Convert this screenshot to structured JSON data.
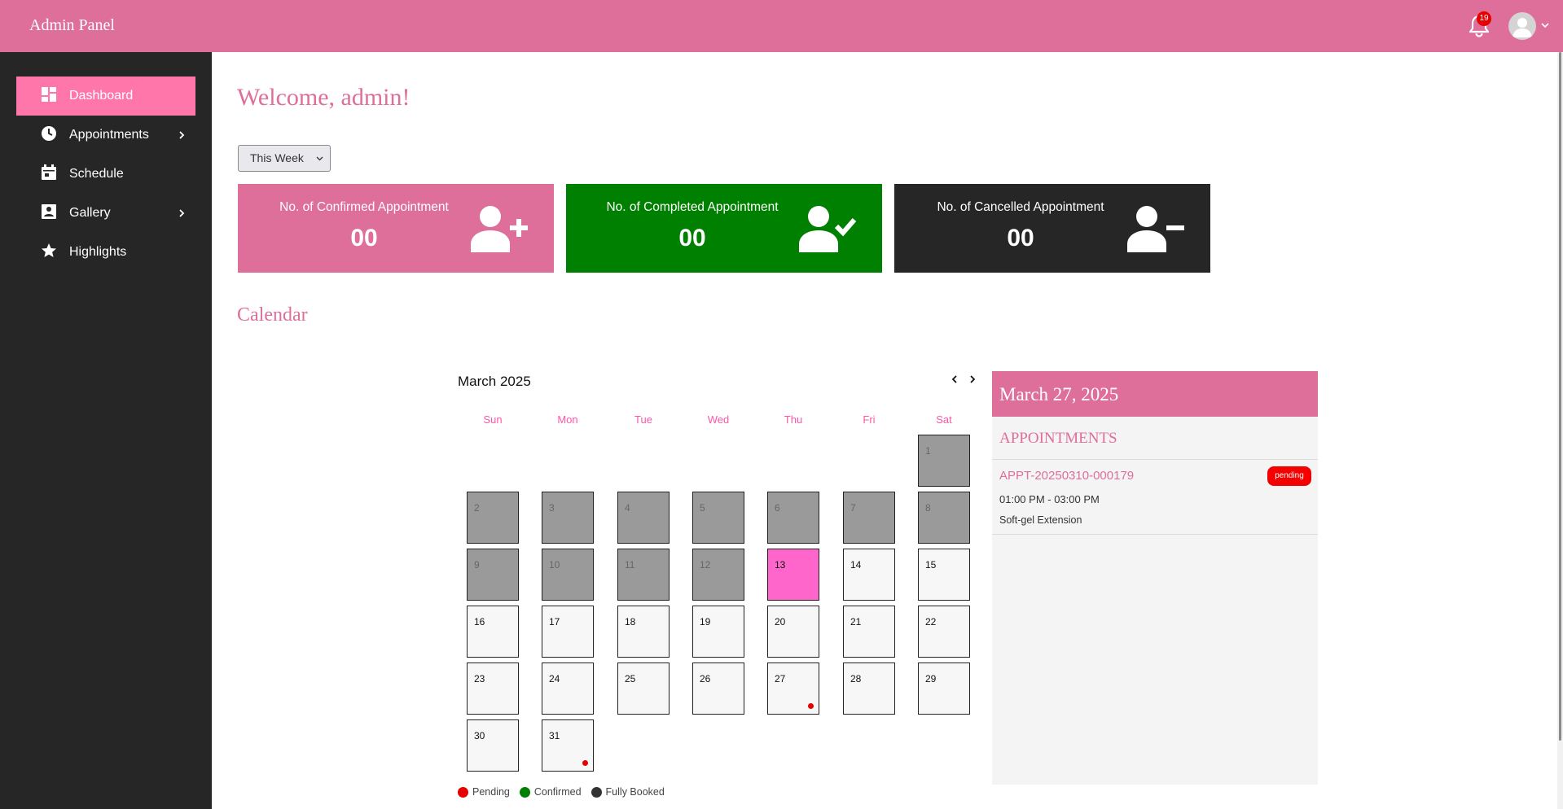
{
  "header": {
    "brand": "Admin Panel",
    "notification_count": "19"
  },
  "sidebar": {
    "items": [
      {
        "label": "Dashboard",
        "icon": "dashboard-icon",
        "active": true,
        "expandable": false
      },
      {
        "label": "Appointments",
        "icon": "clock-icon",
        "active": false,
        "expandable": true
      },
      {
        "label": "Schedule",
        "icon": "calendar-icon",
        "active": false,
        "expandable": false
      },
      {
        "label": "Gallery",
        "icon": "image-icon",
        "active": false,
        "expandable": true
      },
      {
        "label": "Highlights",
        "icon": "star-icon",
        "active": false,
        "expandable": false
      }
    ]
  },
  "main": {
    "welcome": "Welcome, admin!",
    "period_select": "This Week",
    "cards": [
      {
        "title": "No. of Confirmed Appointment",
        "count": "00",
        "color": "#de6e9a",
        "icon": "user-plus-icon"
      },
      {
        "title": "No. of Completed Appointment",
        "count": "00",
        "color": "#008000",
        "icon": "user-check-icon"
      },
      {
        "title": "No. of Cancelled Appointment",
        "count": "00",
        "color": "#262626",
        "icon": "user-minus-icon"
      }
    ],
    "calendar_title": "Calendar"
  },
  "calendar": {
    "month_label": "March 2025",
    "weekdays": [
      "Sun",
      "Mon",
      "Tue",
      "Wed",
      "Thu",
      "Fri",
      "Sat"
    ],
    "days": [
      "1",
      "2",
      "3",
      "4",
      "5",
      "6",
      "7",
      "8",
      "9",
      "10",
      "11",
      "12",
      "13",
      "14",
      "15",
      "16",
      "17",
      "18",
      "19",
      "20",
      "21",
      "22",
      "23",
      "24",
      "25",
      "26",
      "27",
      "28",
      "29",
      "30",
      "31"
    ],
    "today": "13",
    "marked_days": [
      "27",
      "31"
    ],
    "legend": [
      {
        "label": "Pending",
        "color": "#e60000"
      },
      {
        "label": "Confirmed",
        "color": "#008000"
      },
      {
        "label": "Fully Booked",
        "color": "#333333"
      }
    ]
  },
  "appointments_panel": {
    "date": "March 27, 2025",
    "heading": "APPOINTMENTS",
    "item": {
      "id": "APPT-20250310-000179",
      "status": "pending",
      "time": "01:00 PM - 03:00 PM",
      "service": "Soft-gel Extension"
    }
  },
  "colors": {
    "accent": "#de6e9a",
    "active_nav": "#ff77aa",
    "sidebar": "#262626",
    "today": "#ff66cc",
    "past_day": "#9a9a9a"
  }
}
